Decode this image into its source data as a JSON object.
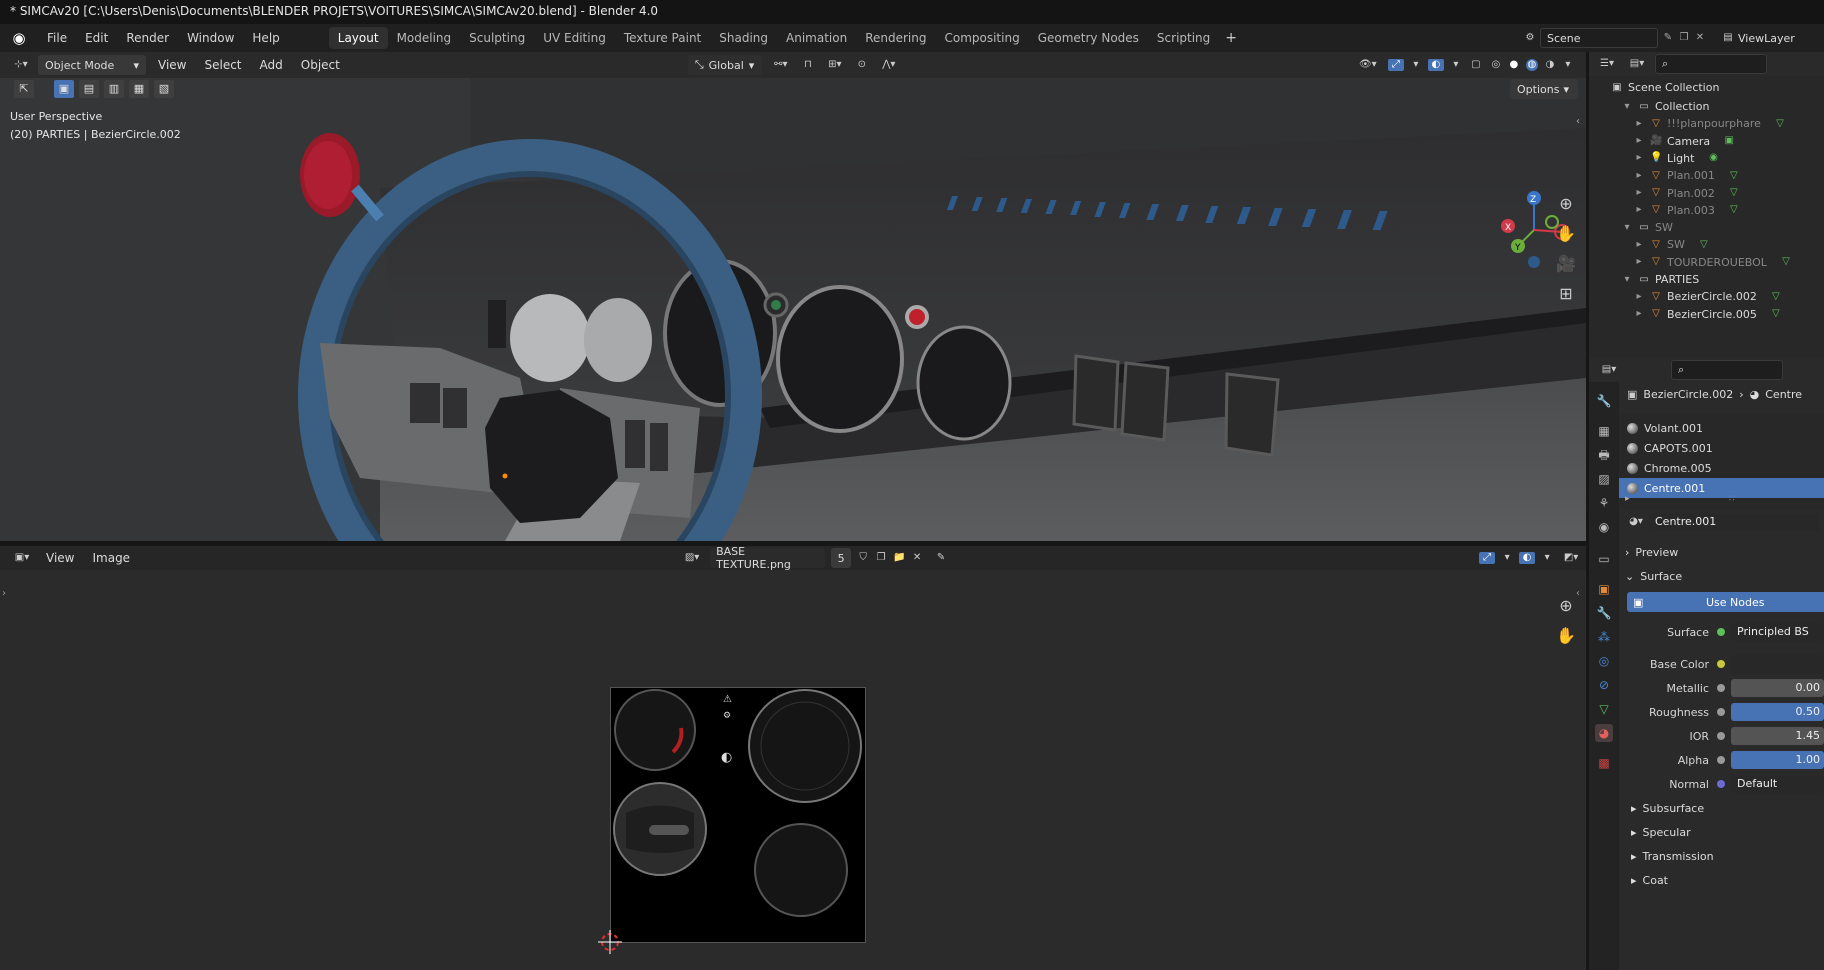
{
  "window": {
    "title": "* SIMCAv20 [C:\\Users\\Denis\\Documents\\BLENDER PROJETS\\VOITURES\\SIMCA\\SIMCAv20.blend] - Blender 4.0"
  },
  "menu": [
    "File",
    "Edit",
    "Render",
    "Window",
    "Help"
  ],
  "workspaces": [
    "Layout",
    "Modeling",
    "Sculpting",
    "UV Editing",
    "Texture Paint",
    "Shading",
    "Animation",
    "Rendering",
    "Compositing",
    "Geometry Nodes",
    "Scripting"
  ],
  "workspace_add": "+",
  "scene": {
    "name": "Scene",
    "view_layer": "ViewLayer"
  },
  "viewport": {
    "mode": "Object Mode",
    "menus": [
      "View",
      "Select",
      "Add",
      "Object"
    ],
    "transform_orientation": "Global",
    "options": "Options",
    "perspective": "User Perspective",
    "context": "(20) PARTIES | BezierCircle.002",
    "gizmo": {
      "z": "Z",
      "y": "Y",
      "x": "X"
    }
  },
  "image_editor": {
    "menus": [
      "View",
      "Image"
    ],
    "image_name": "BASE TEXTURE.png",
    "users": "5"
  },
  "outliner": {
    "root": "Scene Collection",
    "items": [
      {
        "label": "Collection",
        "depth": 1,
        "type": "collection",
        "dim": false
      },
      {
        "label": "!!!planpourphare",
        "depth": 2,
        "type": "mesh",
        "dim": true
      },
      {
        "label": "Camera",
        "depth": 2,
        "type": "camera",
        "dim": false
      },
      {
        "label": "Light",
        "depth": 2,
        "type": "light",
        "dim": false
      },
      {
        "label": "Plan.001",
        "depth": 2,
        "type": "mesh",
        "dim": true
      },
      {
        "label": "Plan.002",
        "depth": 2,
        "type": "mesh",
        "dim": true
      },
      {
        "label": "Plan.003",
        "depth": 2,
        "type": "mesh",
        "dim": true
      },
      {
        "label": "SW",
        "depth": 1,
        "type": "collection",
        "dim": true
      },
      {
        "label": "SW",
        "depth": 2,
        "type": "mesh",
        "dim": true
      },
      {
        "label": "TOURDEROUEBOL",
        "depth": 2,
        "type": "mesh",
        "dim": true
      },
      {
        "label": "PARTIES",
        "depth": 1,
        "type": "collection",
        "dim": false
      },
      {
        "label": "BezierCircle.002",
        "depth": 2,
        "type": "mesh",
        "dim": false
      },
      {
        "label": "BezierCircle.005",
        "depth": 2,
        "type": "mesh",
        "dim": false
      }
    ]
  },
  "properties": {
    "breadcrumb_object": "BezierCircle.002",
    "breadcrumb_material": "Centre",
    "materials": [
      {
        "label": "Volant.001",
        "selected": false
      },
      {
        "label": "CAPOTS.001",
        "selected": false
      },
      {
        "label": "Chrome.005",
        "selected": false
      },
      {
        "label": "Centre.001",
        "selected": true
      }
    ],
    "active_material": "Centre.001",
    "preview": "Preview",
    "surface_header": "Surface",
    "use_nodes": "Use Nodes",
    "fields": [
      {
        "label": "Surface",
        "value": "Principled BS"
      },
      {
        "label": "Base Color",
        "value": ""
      },
      {
        "label": "Metallic",
        "value": "0.00"
      },
      {
        "label": "Roughness",
        "value": "0.50"
      },
      {
        "label": "IOR",
        "value": "1.45"
      },
      {
        "label": "Alpha",
        "value": "1.00"
      },
      {
        "label": "Normal",
        "value": "Default"
      }
    ],
    "subsections": [
      "Subsurface",
      "Specular",
      "Transmission",
      "Coat"
    ]
  },
  "colors": {
    "accent": "#4772b3",
    "header_bg": "#2a2a2a",
    "panel_bg": "#282828"
  }
}
